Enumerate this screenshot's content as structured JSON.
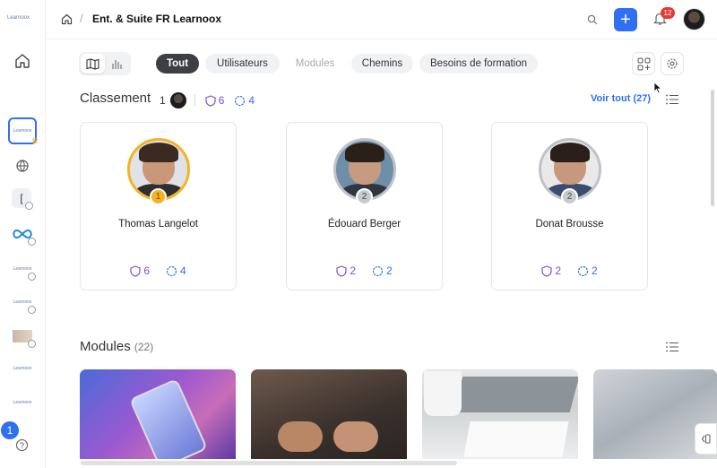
{
  "rail": {
    "logo": "Learnoox",
    "workspace_label": "Learnoox",
    "items": [
      "Learnoox",
      "Learnoox",
      "Learnoox",
      "Learnoox"
    ],
    "bracket_item": "[",
    "notification_count": "1",
    "help": "?"
  },
  "header": {
    "breadcrumb_sep": "/",
    "title": "Ent. & Suite FR Learnoox",
    "bell_badge": "12"
  },
  "toolbar": {
    "chips": [
      {
        "label": "Tout",
        "state": "active"
      },
      {
        "label": "Utilisateurs",
        "state": "normal"
      },
      {
        "label": "Modules",
        "state": "disabled"
      },
      {
        "label": "Chemins",
        "state": "normal"
      },
      {
        "label": "Besoins de formation",
        "state": "normal"
      }
    ]
  },
  "ranking": {
    "title": "Classement",
    "user_rank": "1",
    "badges": "6",
    "points": "4",
    "see_all": "Voir tout (27)",
    "cards": [
      {
        "name": "Thomas Langelot",
        "rank": "1",
        "badges": "6",
        "points": "4"
      },
      {
        "name": "Édouard Berger",
        "rank": "2",
        "badges": "2",
        "points": "2"
      },
      {
        "name": "Donat Brousse",
        "rank": "2",
        "badges": "2",
        "points": "2"
      }
    ]
  },
  "modules": {
    "title": "Modules",
    "count": "(22)"
  },
  "colors": {
    "accent": "#2f6ff2",
    "badge_purple": "#7b4fd6",
    "gold": "#f5b324",
    "notification_red": "#e53935"
  }
}
